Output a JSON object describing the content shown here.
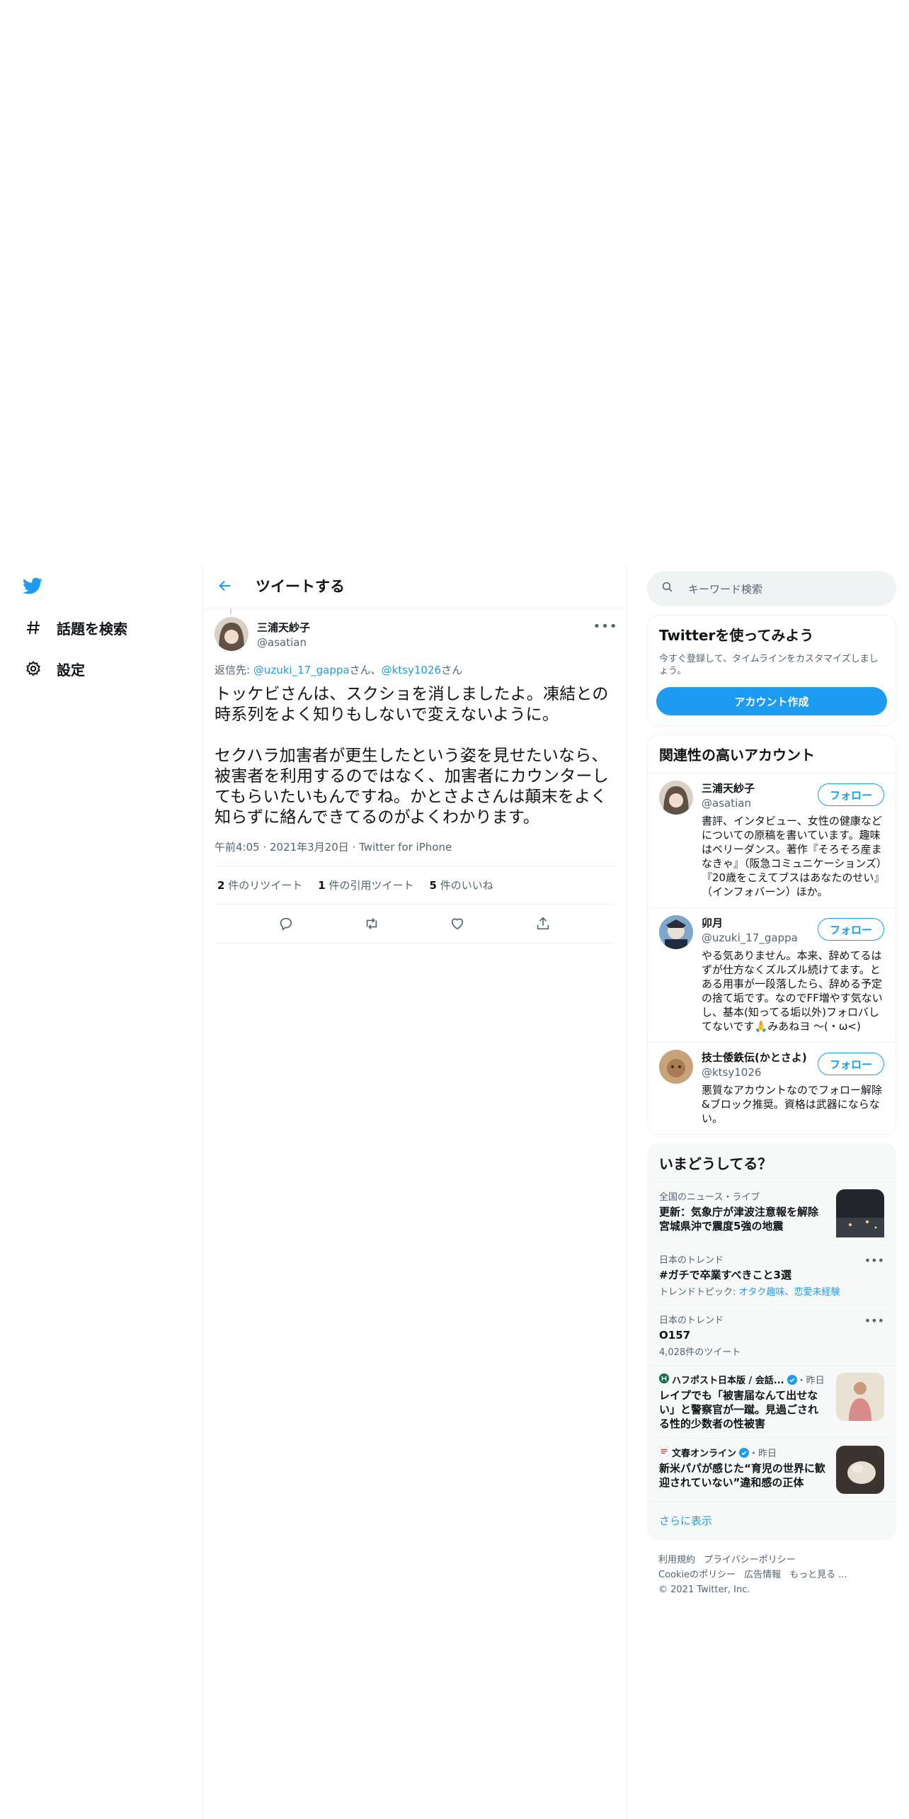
{
  "nav": {
    "items": [
      {
        "label": "話題を検索",
        "icon": "hashtag-icon"
      },
      {
        "label": "設定",
        "icon": "gear-icon"
      }
    ]
  },
  "header": {
    "title": "ツイートする"
  },
  "tweet": {
    "author_name": "三浦天紗子",
    "author_handle": "@asatian",
    "reply_prefix": "返信先: ",
    "reply_mentions": [
      "@uzuki_17_gappa",
      "@ktsy1026"
    ],
    "reply_suffix_1": "さん、",
    "reply_suffix_2": "さん",
    "text": "トッケビさんは、スクショを消しましたよ。凍結との時系列をよく知りもしないで変えないように。\n\nセクハラ加害者が更生したという姿を見せたいなら、被害者を利用するのではなく、加害者にカウンターしてもらいたいもんですね。かとさよさんは顛末をよく知らずに絡んできてるのがよくわかります。",
    "time": "午前4:05",
    "date": "2021年3月20日",
    "source": "Twitter for iPhone",
    "stats": {
      "retweets": "2",
      "retweets_label": "件のリツイート",
      "quotes": "1",
      "quotes_label": "件の引用ツイート",
      "likes": "5",
      "likes_label": "件のいいね"
    }
  },
  "search": {
    "placeholder": "キーワード検索"
  },
  "cta": {
    "title": "Twitterを使ってみよう",
    "subtitle": "今すぐ登録して、タイムラインをカスタマイズしましょう。",
    "button": "アカウント作成"
  },
  "related": {
    "title": "関連性の高いアカウント",
    "follow_label": "フォロー",
    "accounts": [
      {
        "name": "三浦天紗子",
        "handle": "@asatian",
        "bio": "書評、インタビュー、女性の健康などについての原稿を書いています。趣味はベリーダンス。著作『そろそろ産まなきゃ』（阪急コミュニケーションズ）『20歳をこえてブスはあなたのせい』（インフォバーン）ほか。"
      },
      {
        "name": "卯月",
        "handle": "@uzuki_17_gappa",
        "bio": "やる気ありません。本来、辞めてるはずが仕方なくズルズル続けてます。とある用事が一段落したら、辞める予定の捨て垢です。なのでFF増やす気ないし、基本(知ってる垢以外)フォロバしてないです🙏みあねヨ ～(・ω<)"
      },
      {
        "name": "技士倭鉄伝(かとさよ)",
        "handle": "@ktsy1026",
        "bio": "悪質なアカウントなのでフォロー解除&ブロック推奨。資格は武器にならない。"
      }
    ]
  },
  "trends": {
    "title": "いまどうしてる？",
    "items": [
      {
        "context": "全国のニュース・ライブ",
        "name": "更新：気象庁が津波注意報を解除　宮城県沖で震度5強の地震"
      },
      {
        "context": "日本のトレンド",
        "name": "#ガチで卒業すべきこと3選",
        "sub_prefix": "トレンドトピック: ",
        "sub_links": "オタク趣味、恋愛未経験"
      },
      {
        "context": "日本のトレンド",
        "name": "O157",
        "sub": "4,028件のツイート"
      },
      {
        "source": "ハフポスト日本版 / 会話...",
        "time": "・昨日",
        "name": "レイプでも「被害届なんて出せない」と警察官が一蹴。見過ごされる性的少数者の性被害"
      },
      {
        "source": "文春オンライン",
        "time": "・昨日",
        "name": "新米パパが感じた“育児の世界に歓迎されていない”違和感の正体"
      }
    ],
    "show_more": "さらに表示"
  },
  "footer": {
    "links_row1": [
      "利用規約",
      "プライバシーポリシー"
    ],
    "links_row2": [
      "Cookieのポリシー",
      "広告情報",
      "もっと見る ..."
    ],
    "copyright": "© 2021 Twitter, Inc."
  },
  "colors": {
    "accent": "#1d9bf0",
    "text": "#0f1419",
    "muted": "#536471",
    "border": "#eff3f4"
  }
}
